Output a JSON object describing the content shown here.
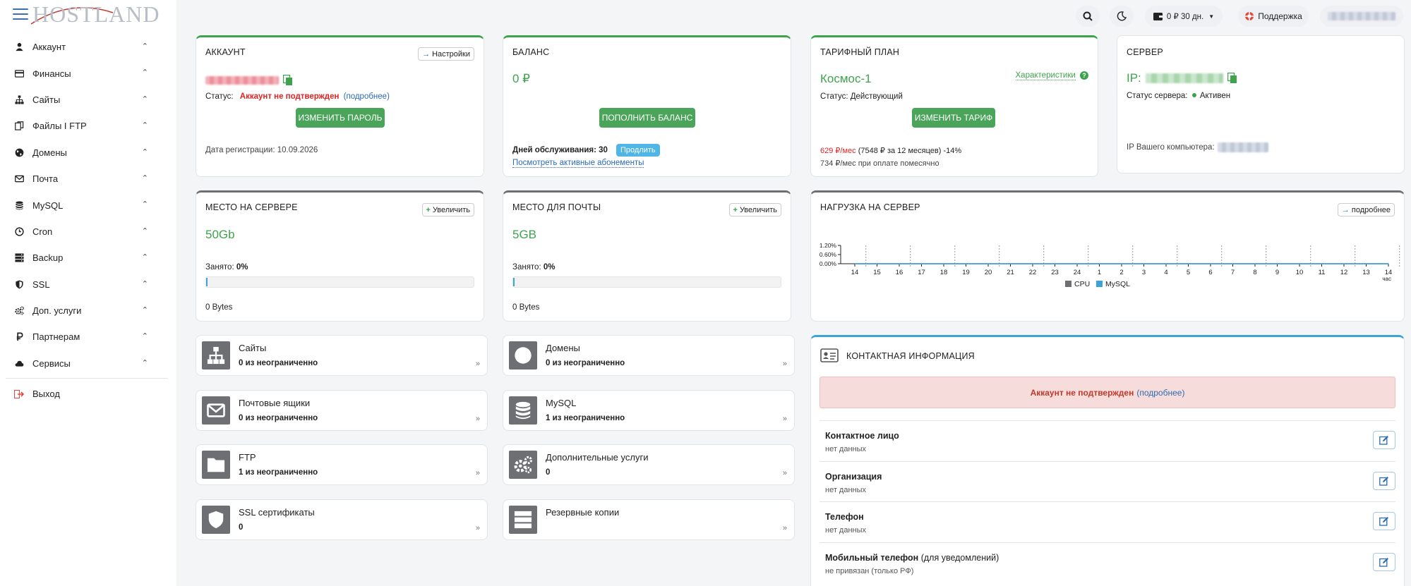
{
  "brand": {
    "logo_text": "HOSTLAND"
  },
  "sidebar": {
    "items": [
      {
        "label": "Аккаунт",
        "icon": "user-icon"
      },
      {
        "label": "Финансы",
        "icon": "credit-card-icon"
      },
      {
        "label": "Сайты",
        "icon": "sitemap-icon"
      },
      {
        "label": "Файлы I FTP",
        "icon": "files-icon"
      },
      {
        "label": "Домены",
        "icon": "globe-icon"
      },
      {
        "label": "Почта",
        "icon": "envelope-icon"
      },
      {
        "label": "MySQL",
        "icon": "database-icon"
      },
      {
        "label": "Cron",
        "icon": "clock-icon"
      },
      {
        "label": "Backup",
        "icon": "server-icon"
      },
      {
        "label": "SSL",
        "icon": "shield-icon"
      },
      {
        "label": "Доп. услуги",
        "icon": "gears-icon"
      },
      {
        "label": "Партнерам",
        "icon": "ruble-icon"
      },
      {
        "label": "Сервисы",
        "icon": "cloud-icon"
      }
    ],
    "exit": {
      "label": "Выход",
      "icon": "sign-out-icon"
    }
  },
  "topbar": {
    "balance": "0 ₽ 30 дн.",
    "support": "Поддержка"
  },
  "account": {
    "title": "АККАУНТ",
    "settings_btn": "Настройки",
    "status_label": "Статус:",
    "status_value": "Аккаунт не подтвержден",
    "status_more": "подробнее",
    "paren_open": "(",
    "paren_close": ")",
    "change_password_btn": "ИЗМЕНИТЬ ПАРОЛЬ",
    "reg_date": "Дата регистрации: 10.09.2026"
  },
  "balance": {
    "title": "БАЛАНС",
    "amount": "0 ₽",
    "topup_btn": "ПОПОЛНИТЬ БАЛАНС",
    "service_days": "Дней обслуживания: 30",
    "extend_btn": "Продлить",
    "active_subs": "Посмотреть активные абонементы"
  },
  "tariff": {
    "title": "ТАРИФНЫЙ ПЛАН",
    "name": "Космос-1",
    "features_link": "Характеристики",
    "status": "Статус: Действующий",
    "change_btn": "ИЗМЕНИТЬ ТАРИФ",
    "price_red": "629 ₽/мес",
    "price_rest": "(7548 ₽ за 12 месяцев) -14%",
    "price_monthly": "734 ₽/мес при оплате помесячно"
  },
  "server": {
    "title": "СЕРВЕР",
    "ip_label": "IP:",
    "status_label": "Статус сервера:",
    "status_value": "Активен",
    "client_ip_label": "IP Вашего компьютера:",
    "status_color": "#3fa34d"
  },
  "disk": {
    "title": "МЕСТО НА СЕРВЕРЕ",
    "increase_btn": "Увеличить",
    "size": "50Gb",
    "used_label": "Занято:",
    "used_value": "0%",
    "used_fraction": 0,
    "bytes": "0 Bytes"
  },
  "mail_space": {
    "title": "МЕСТО ДЛЯ ПОЧТЫ",
    "increase_btn": "Увеличить",
    "size": "5GB",
    "used_label": "Занято:",
    "used_value": "0%",
    "used_fraction": 0,
    "bytes": "0 Bytes"
  },
  "load": {
    "title": "НАГРУЗКА НА СЕРВЕР",
    "more_btn": "подробнее"
  },
  "chart_data": {
    "type": "line",
    "x": [
      "14",
      "15",
      "16",
      "17",
      "18",
      "19",
      "20",
      "21",
      "22",
      "23",
      "24",
      "1",
      "2",
      "3",
      "4",
      "5",
      "6",
      "7",
      "8",
      "9",
      "10",
      "11",
      "12",
      "13",
      "14"
    ],
    "x_unit": "час",
    "y_ticks": [
      "1.20%",
      "0.60%",
      "0.00%"
    ],
    "ylim": [
      0,
      1.2
    ],
    "series": [
      {
        "name": "CPU",
        "color": "#6d6f73",
        "values": [
          0,
          0,
          0,
          0,
          0,
          0,
          0,
          0,
          0,
          0,
          0,
          0,
          0,
          0,
          0,
          0,
          0,
          0,
          0,
          0,
          0,
          0,
          0,
          0,
          0
        ]
      },
      {
        "name": "MySQL",
        "color": "#3ca3d9",
        "values": [
          0,
          0,
          0,
          0,
          0,
          0,
          0,
          0,
          0,
          0,
          0,
          0,
          0,
          0,
          0,
          0,
          0,
          0,
          0,
          0,
          0,
          0,
          0,
          0,
          0
        ]
      }
    ],
    "legend": "bottom"
  },
  "tiles": [
    {
      "name": "Сайты",
      "count_num": "0",
      "count_text": "из неограниченно",
      "icon": "sitemap-icon"
    },
    {
      "name": "Домены",
      "count_num": "0",
      "count_text": "из неограниченно",
      "icon": "globe-icon"
    },
    {
      "name": "Почтовые ящики",
      "count_num": "0",
      "count_text": "из неограниченно",
      "icon": "envelope-icon"
    },
    {
      "name": "MySQL",
      "count_num": "1",
      "count_text": "из неограниченно",
      "icon": "database-icon"
    },
    {
      "name": "FTP",
      "count_num": "1",
      "count_text": "из неограниченно",
      "icon": "folder-icon"
    },
    {
      "name": "Дополнительные услуги",
      "count_num": "0",
      "count_text": "",
      "icon": "gears-icon"
    },
    {
      "name": "SSL сертификаты",
      "count_num": "0",
      "count_text": "",
      "icon": "shield-icon"
    },
    {
      "name": "Резервные копии",
      "count_num": "",
      "count_text": "",
      "icon": "server-icon"
    }
  ],
  "contact": {
    "title": "КОНТАКТНАЯ ИНФОРМАЦИЯ",
    "alert_msg": "Аккаунт не подтвержден",
    "alert_more": "подробнее",
    "rows": [
      {
        "label": "Контактное лицо",
        "label_suffix": "",
        "value": "нет данных"
      },
      {
        "label": "Организация",
        "label_suffix": "",
        "value": "нет данных"
      },
      {
        "label": "Телефон",
        "label_suffix": "",
        "value": "нет данных"
      },
      {
        "label": "Мобильный телефон",
        "label_suffix": "(для уведомлений)",
        "value": "не привязан (только РФ)"
      }
    ]
  }
}
